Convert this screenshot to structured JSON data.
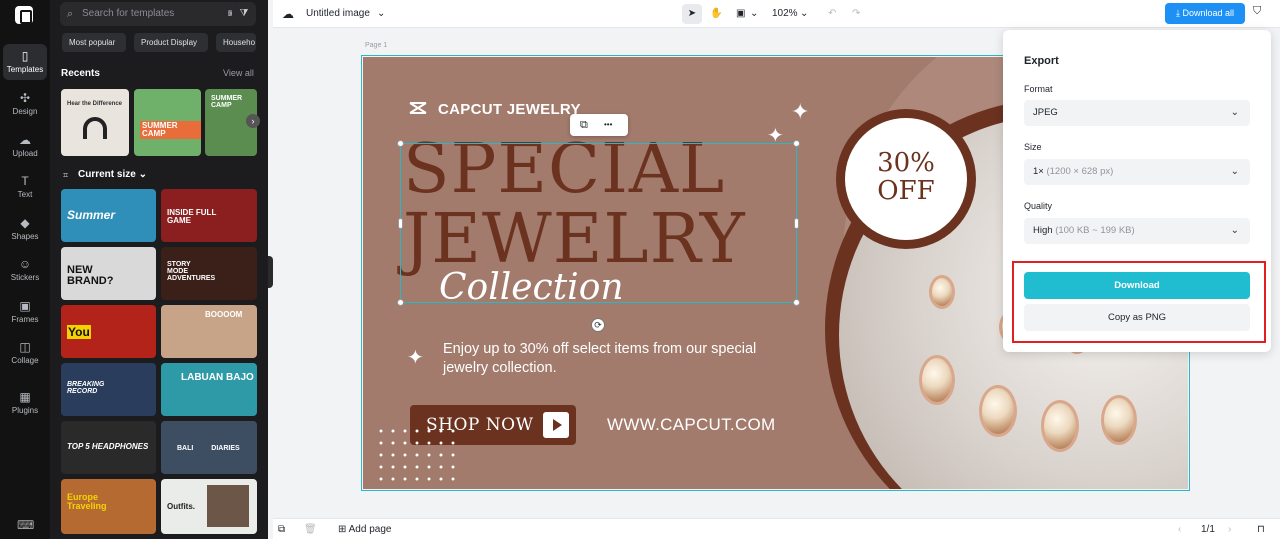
{
  "rail": {
    "items": [
      {
        "label": "Templates",
        "icon": "templates-icon",
        "glyph": "▯"
      },
      {
        "label": "Design",
        "icon": "design-icon",
        "glyph": "✣"
      },
      {
        "label": "Upload",
        "icon": "upload-icon",
        "glyph": "☁"
      },
      {
        "label": "Text",
        "icon": "text-icon",
        "glyph": "T"
      },
      {
        "label": "Shapes",
        "icon": "shapes-icon",
        "glyph": "◆"
      },
      {
        "label": "Stickers",
        "icon": "stickers-icon",
        "glyph": "☺"
      },
      {
        "label": "Frames",
        "icon": "frames-icon",
        "glyph": "▣"
      },
      {
        "label": "Collage",
        "icon": "collage-icon",
        "glyph": "◫"
      },
      {
        "label": "Plugins",
        "icon": "plugins-icon",
        "glyph": "▦"
      }
    ],
    "keyboard_glyph": "⌨"
  },
  "panel": {
    "search_placeholder": "Search for templates",
    "search_glyph": "⌕",
    "camera_glyph": "◙",
    "filter_glyph": "⧩",
    "chips": [
      "Most popular",
      "Product Display",
      "Househo"
    ],
    "recents_title": "Recents",
    "view_all": "View all",
    "current_size": "Current size",
    "recents": [
      {
        "text": "Hear the Difference",
        "bg": "#e9e4de"
      },
      {
        "text": "SUMMER CAMP",
        "bg": "#6fb06a"
      },
      {
        "text": "SUMMER CAMP",
        "bg": "#5a8d4f"
      }
    ],
    "templates": [
      {
        "text": "Summer",
        "bg": "#2f8fb8"
      },
      {
        "text": "INSIDE FULL GAME",
        "bg": "#8b1f1f"
      },
      {
        "text": "NEW BRAND?",
        "bg": "#d9d9d9"
      },
      {
        "text": "STORY MODE ADVENTURES",
        "bg": "#3a2019"
      },
      {
        "text": "You",
        "bg": "#b42319"
      },
      {
        "text": "BOOOOM",
        "bg": "#c7a487"
      },
      {
        "text": "BREAKING RECORD",
        "bg": "#2a3d5c"
      },
      {
        "text": "LABUAN BAJO",
        "bg": "#2e9aa8"
      },
      {
        "text": "TOP 5 HEADPHONES",
        "bg": "#2a2a2a"
      },
      {
        "text": "BALI DIARIES",
        "bg": "#3d4e63"
      },
      {
        "text": "Europe Traveling",
        "bg": "#b56a32"
      },
      {
        "text": "Outfits.",
        "bg": "#e9ece9"
      }
    ],
    "scroll_arrow": "›"
  },
  "topbar": {
    "title": "Untitled image",
    "zoom": "102%",
    "download_all": "Download all",
    "cloud_glyph": "☁",
    "chevron": "⌄",
    "pointer_glyph": "➤",
    "hand_glyph": "✋",
    "layout_glyph": "▣",
    "undo_glyph": "↶",
    "redo_glyph": "↷",
    "shield_glyph": "⛉"
  },
  "canvas": {
    "page_label": "Page 1",
    "brand": "CAPCUT JEWELRY",
    "headline_1": "SPECIAL",
    "headline_2": "JEWELRY",
    "collection": "Collection",
    "offer_1": "30%",
    "offer_2": "OFF",
    "sub_text": "Enjoy up to 30% off select items from our special jewelry collection.",
    "shop_now": "SHOP NOW",
    "url": "WWW.CAPCUT.COM",
    "spark_glyph": "✦",
    "copy_glyph": "⧉",
    "more_glyph": "•••",
    "rotate_glyph": "⟳"
  },
  "export": {
    "title": "Export",
    "format_label": "Format",
    "format_value": "JPEG",
    "size_label": "Size",
    "size_value": "1×",
    "size_detail": "(1200 × 628 px)",
    "quality_label": "Quality",
    "quality_value": "High",
    "quality_detail": "(100 KB ~ 199 KB)",
    "download": "Download",
    "copy_png": "Copy as PNG",
    "chevron": "⌄"
  },
  "bottombar": {
    "add_page": "Add page",
    "page_count": "1/1",
    "copy_glyph": "⧉",
    "trash_glyph": "🗑",
    "plus_glyph": "⊞",
    "prev_glyph": "‹",
    "next_glyph": "›",
    "lock_glyph": "⊓"
  },
  "colors": {
    "accent": "#20bdd0",
    "download_all": "#1d90f5",
    "design_bg": "#a27b6d",
    "brown": "#6b3220",
    "highlight": "#e02020"
  }
}
